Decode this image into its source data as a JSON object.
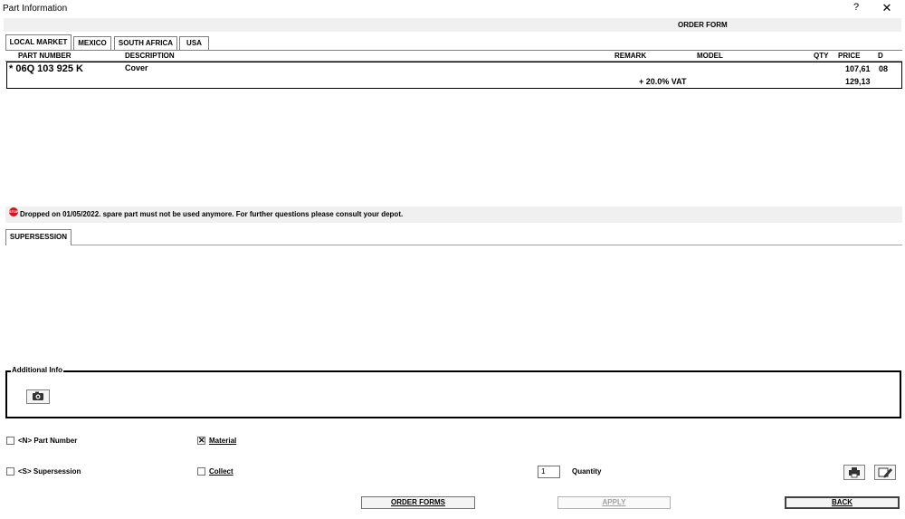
{
  "window": {
    "title": "Part Information",
    "help_label": "?",
    "close_label": "✕"
  },
  "order_form_label": "ORDER FORM",
  "market_tabs": [
    "LOCAL MARKET",
    "MEXICO",
    "SOUTH AFRICA",
    "USA"
  ],
  "table": {
    "headers": {
      "part_number": "PART NUMBER",
      "description": "DESCRIPTION",
      "remark": "REMARK",
      "model": "MODEL",
      "qty": "QTY",
      "price": "PRICE",
      "d": "D"
    },
    "row": {
      "part_number": "* 06Q 103 925 K",
      "description": "Cover",
      "price": "107,61",
      "d": "08",
      "vat_label": "+ 20.0% VAT",
      "vat_price": "129,13"
    }
  },
  "notice": {
    "icon": "stop-icon",
    "text": "Dropped on 01/05/2022. spare part must not be used anymore. For further questions please consult your depot."
  },
  "supersession_tab": "SUPERSESSION",
  "additional_info": {
    "legend": "Additional Info",
    "icon": "camera-icon"
  },
  "options": {
    "part_number": {
      "label": "<N> Part Number",
      "checked": false
    },
    "material": {
      "label": "Material",
      "checked": true
    },
    "supersession": {
      "label": "<S> Supersession",
      "checked": false
    },
    "collect": {
      "label": "Collect",
      "checked": false
    }
  },
  "quantity": {
    "value": "1",
    "label": "Quantity"
  },
  "toolbar_icons": [
    "print-icon",
    "edit-icon"
  ],
  "buttons": {
    "order_forms": "ORDER FORMS",
    "apply": "APPLY",
    "back": "BACK"
  }
}
